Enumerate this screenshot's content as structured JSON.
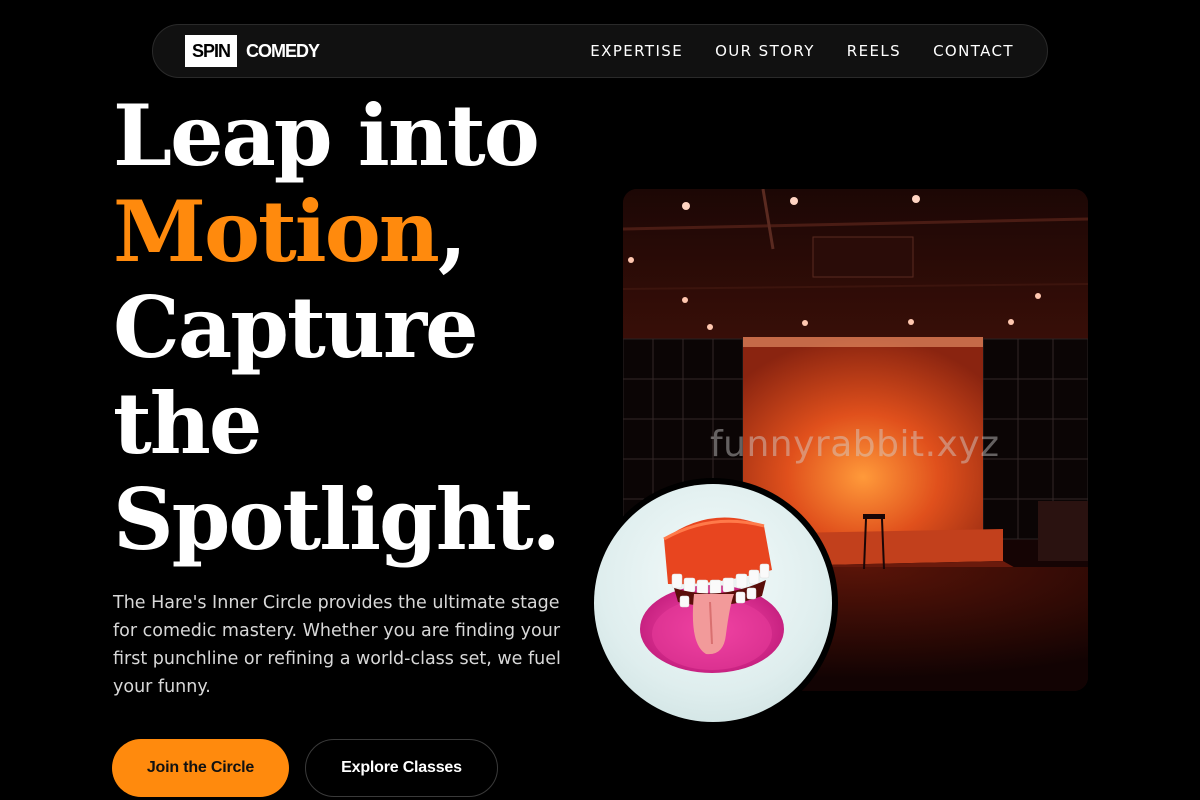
{
  "brand": {
    "box_text": "SPIN",
    "text": "COMEDY"
  },
  "nav": {
    "items": [
      "EXPERTISE",
      "OUR STORY",
      "REELS",
      "CONTACT"
    ]
  },
  "hero": {
    "line1": "Leap into",
    "line2_accent": "Motion",
    "line2_rest": ",",
    "line3": "Capture",
    "line4": "the",
    "line5": "Spotlight.",
    "description": "The Hare's Inner Circle provides the ultimate stage for comedic mastery. Whether you are finding your first punchline or refining a world-class set, we fuel your funny."
  },
  "buttons": {
    "primary": "Join the Circle",
    "secondary": "Explore Classes"
  },
  "watermark": "funnyrabbit.xyz",
  "colors": {
    "accent": "#ff8a0d",
    "background": "#000000",
    "nav_bg": "#111111"
  }
}
